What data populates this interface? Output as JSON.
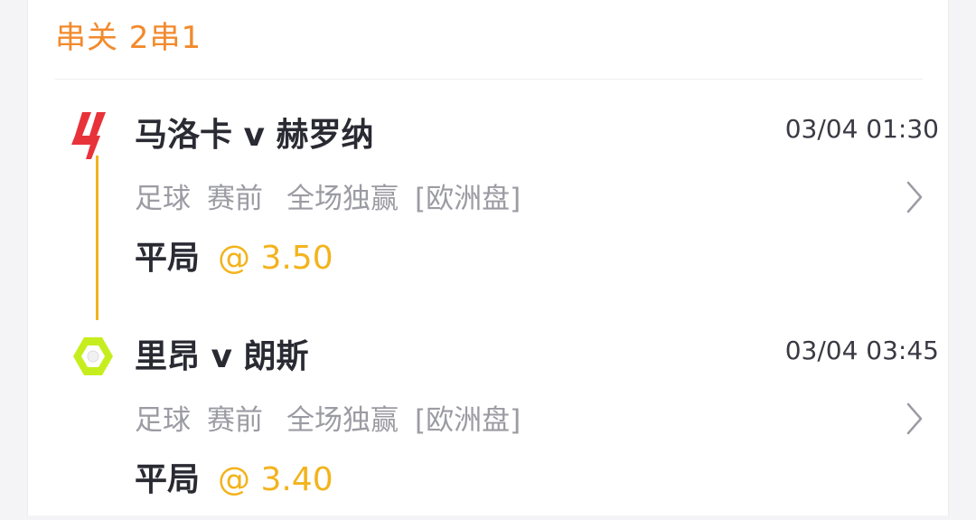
{
  "header": {
    "title": "串关 2串1"
  },
  "matches": [
    {
      "league_icon": "laliga-logo-icon",
      "teams": "马洛卡 v 赫罗纳",
      "time": "03/04 01:30",
      "sport": "足球",
      "stage": "赛前",
      "market": "全场独赢",
      "odds_type": "[欧洲盘]",
      "selection": "平局",
      "odds": "@ 3.50"
    },
    {
      "league_icon": "ligue1-logo-icon",
      "teams": "里昂 v 朗斯",
      "time": "03/04 03:45",
      "sport": "足球",
      "stage": "赛前",
      "market": "全场独赢",
      "odds_type": "[欧洲盘]",
      "selection": "平局",
      "odds": "@ 3.40"
    }
  ],
  "colors": {
    "accent_orange": "#f28a2d",
    "odds_yellow": "#f3b31c",
    "laliga_red": "#e8323a",
    "ligue1_green": "#c6ee1f"
  }
}
